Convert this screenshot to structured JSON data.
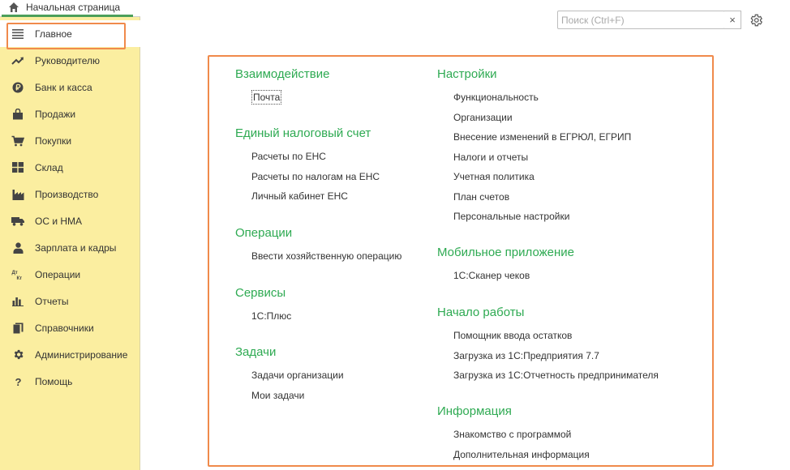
{
  "home_tab": {
    "label": "Начальная страница",
    "icon": "home-icon"
  },
  "search": {
    "placeholder": "Поиск (Ctrl+F)",
    "value": "",
    "clear_label": "×"
  },
  "colors": {
    "accent": "#2eaa52",
    "highlight": "#f08a4b",
    "sidebar_bg": "#fbeea0"
  },
  "sidebar": {
    "items": [
      {
        "label": "Главное",
        "icon": "menu-icon",
        "active": true
      },
      {
        "label": "Руководителю",
        "icon": "trend-icon"
      },
      {
        "label": "Банк и касса",
        "icon": "ruble-icon"
      },
      {
        "label": "Продажи",
        "icon": "bag-icon"
      },
      {
        "label": "Покупки",
        "icon": "cart-icon"
      },
      {
        "label": "Склад",
        "icon": "warehouse-icon"
      },
      {
        "label": "Производство",
        "icon": "factory-icon"
      },
      {
        "label": "ОС и НМА",
        "icon": "truck-icon"
      },
      {
        "label": "Зарплата и кадры",
        "icon": "person-icon"
      },
      {
        "label": "Операции",
        "icon": "debit-credit-icon",
        "icon_text_top": "Дт",
        "icon_text_bottom": "Кт"
      },
      {
        "label": "Отчеты",
        "icon": "bar-chart-icon"
      },
      {
        "label": "Справочники",
        "icon": "books-icon"
      },
      {
        "label": "Администрирование",
        "icon": "gear-icon"
      },
      {
        "label": "Помощь",
        "icon": "help-icon",
        "icon_text": "?"
      }
    ]
  },
  "main": {
    "left_column": [
      {
        "title": "Взаимодействие",
        "links": [
          "Почта"
        ]
      },
      {
        "title": "Единый налоговый счет",
        "links": [
          "Расчеты по ЕНС",
          "Расчеты по налогам на ЕНС",
          "Личный кабинет ЕНС"
        ]
      },
      {
        "title": "Операции",
        "links": [
          "Ввести хозяйственную операцию"
        ]
      },
      {
        "title": "Сервисы",
        "links": [
          "1С:Плюс"
        ]
      },
      {
        "title": "Задачи",
        "links": [
          "Задачи организации",
          "Мои задачи"
        ]
      }
    ],
    "right_column": [
      {
        "title": "Настройки",
        "links": [
          "Функциональность",
          "Организации",
          "Внесение изменений в ЕГРЮЛ, ЕГРИП",
          "Налоги и отчеты",
          "Учетная политика",
          "План счетов",
          "Персональные настройки"
        ]
      },
      {
        "title": "Мобильное приложение",
        "links": [
          "1С:Сканер чеков"
        ]
      },
      {
        "title": "Начало работы",
        "links": [
          "Помощник ввода остатков",
          "Загрузка из 1С:Предприятия 7.7",
          "Загрузка из 1С:Отчетность предпринимателя"
        ]
      },
      {
        "title": "Информация",
        "links": [
          "Знакомство с программой",
          "Дополнительная информация"
        ]
      }
    ]
  }
}
